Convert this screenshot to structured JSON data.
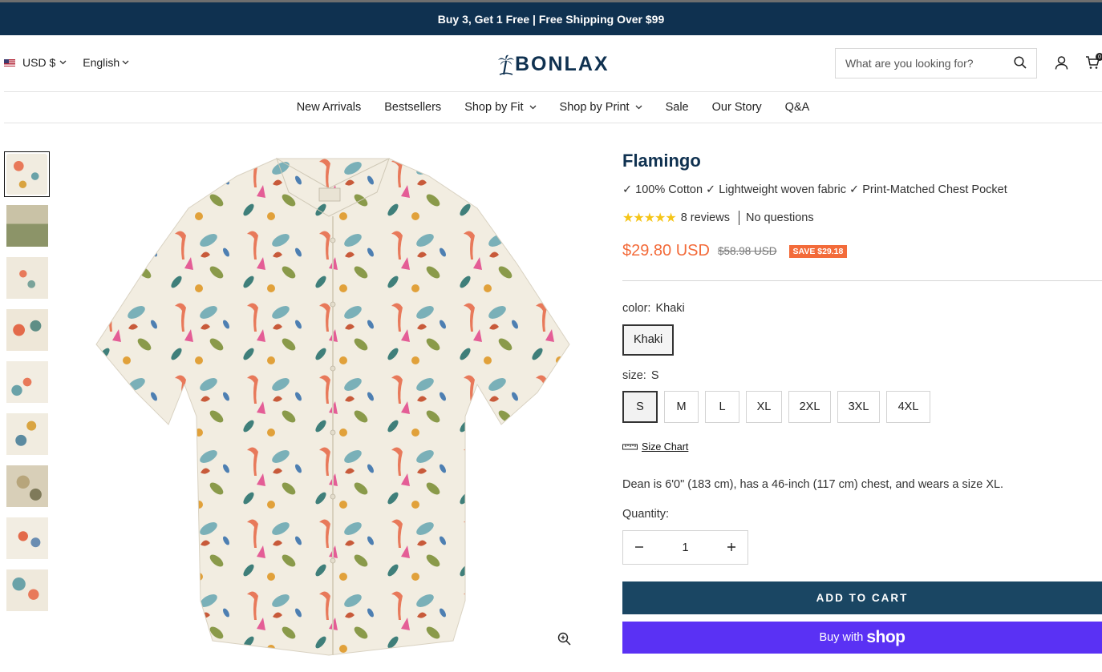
{
  "announcement": "Buy 3, Get 1 Free | Free Shipping Over $99",
  "header": {
    "currency": "USD $",
    "language": "English",
    "logo_text": "BONLAX",
    "search_placeholder": "What are you looking for?",
    "cart_count": "0"
  },
  "nav": {
    "items": [
      {
        "label": "New Arrivals"
      },
      {
        "label": "Bestsellers"
      },
      {
        "label": "Shop by Fit"
      },
      {
        "label": "Shop by Print"
      },
      {
        "label": "Sale"
      },
      {
        "label": "Our Story"
      },
      {
        "label": "Q&A"
      }
    ]
  },
  "gallery": {
    "thumbnail_count": 9,
    "active_index": 0
  },
  "product": {
    "title": "Flamingo",
    "features": "✓ 100% Cotton ✓ Lightweight woven fabric ✓ Print-Matched Chest Pocket",
    "rating_stars": 5,
    "reviews": "8 reviews",
    "questions": "No questions",
    "price": "$29.80 USD",
    "compare_price": "$58.98 USD",
    "save_badge": "SAVE $29.18",
    "color_label": "color:",
    "color_value": "Khaki",
    "color_options": [
      "Khaki"
    ],
    "size_label": "size:",
    "size_value": "S",
    "sizes": [
      "S",
      "M",
      "L",
      "XL",
      "2XL",
      "3XL",
      "4XL"
    ],
    "size_chart_label": "Size Chart",
    "fit_note": "Dean is 6'0\" (183 cm), has a 46-inch (117 cm) chest, and wears a size XL.",
    "quantity_label": "Quantity:",
    "quantity": "1",
    "add_to_cart": "ADD TO CART",
    "buy_with": "Buy with",
    "shop_brand": "shop"
  },
  "colors": {
    "announcement_bg": "#0f3150",
    "brand": "#0f3150",
    "price": "#f36b3a",
    "add_to_cart_bg": "#1a4663",
    "shop_pay": "#5a31f4",
    "star": "#f5c518"
  }
}
